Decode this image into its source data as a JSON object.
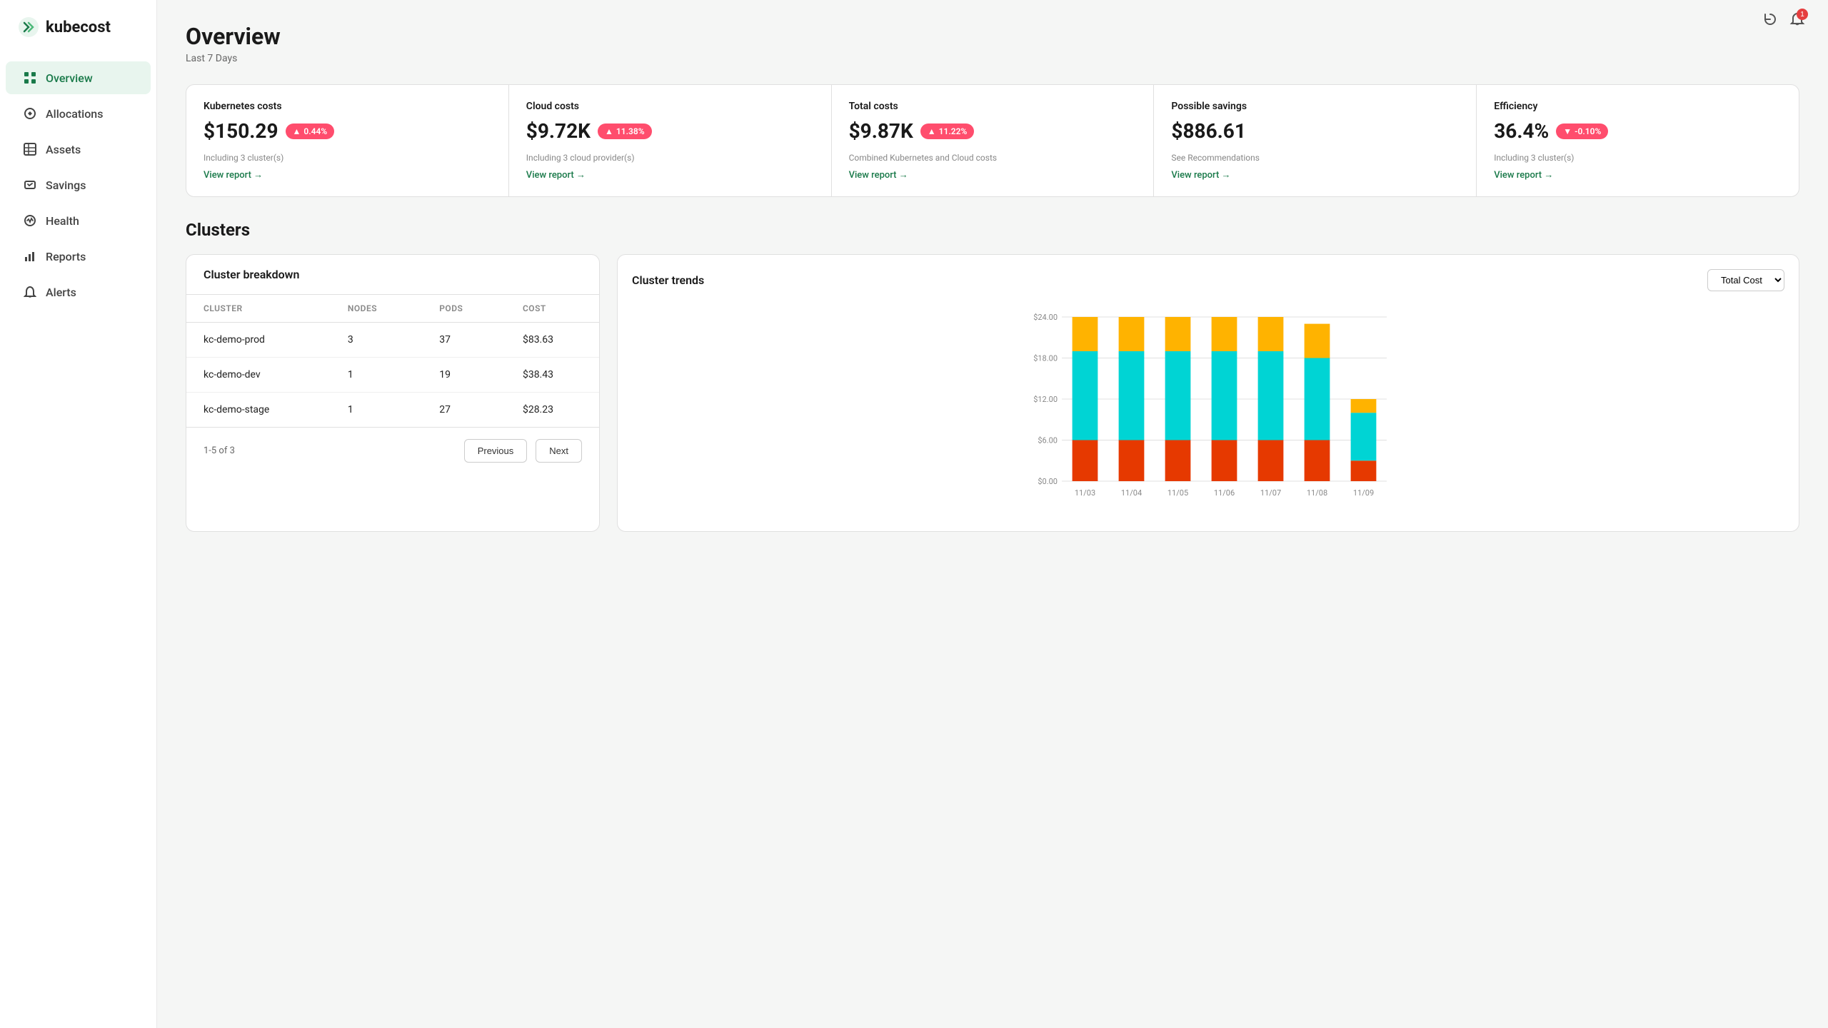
{
  "app": {
    "name": "kubecost",
    "logo_text": "kubecost"
  },
  "sidebar": {
    "items": [
      {
        "id": "overview",
        "label": "Overview",
        "icon": "grid-icon",
        "active": true
      },
      {
        "id": "allocations",
        "label": "Allocations",
        "icon": "tag-icon",
        "active": false
      },
      {
        "id": "assets",
        "label": "Assets",
        "icon": "table-icon",
        "active": false
      },
      {
        "id": "savings",
        "label": "Savings",
        "icon": "savings-icon",
        "active": false
      },
      {
        "id": "health",
        "label": "Health",
        "icon": "circle-icon",
        "active": false
      },
      {
        "id": "reports",
        "label": "Reports",
        "icon": "bar-icon",
        "active": false
      },
      {
        "id": "alerts",
        "label": "Alerts",
        "icon": "bell-icon",
        "active": false
      }
    ]
  },
  "header": {
    "title": "Overview",
    "subtitle": "Last 7 Days",
    "refresh_icon": "↻",
    "notification_icon": "🔔",
    "notification_count": "1"
  },
  "cost_cards": [
    {
      "id": "kubernetes-costs",
      "title": "Kubernetes costs",
      "value": "$150.29",
      "badge_value": "0.44%",
      "badge_direction": "up",
      "description": "Including 3 cluster(s)",
      "view_report_label": "View report →"
    },
    {
      "id": "cloud-costs",
      "title": "Cloud costs",
      "value": "$9.72K",
      "badge_value": "11.38%",
      "badge_direction": "up",
      "description": "Including 3 cloud provider(s)",
      "view_report_label": "View report →"
    },
    {
      "id": "total-costs",
      "title": "Total costs",
      "value": "$9.87K",
      "badge_value": "11.22%",
      "badge_direction": "up",
      "description": "Combined Kubernetes and Cloud costs",
      "view_report_label": "View report →"
    },
    {
      "id": "possible-savings",
      "title": "Possible savings",
      "value": "$886.61",
      "badge_value": null,
      "badge_direction": null,
      "description": "See Recommendations",
      "view_report_label": "View report →"
    },
    {
      "id": "efficiency",
      "title": "Efficiency",
      "value": "36.4%",
      "badge_value": "-0.10%",
      "badge_direction": "down",
      "description": "Including 3 cluster(s)",
      "view_report_label": "View report →"
    }
  ],
  "clusters": {
    "section_title": "Clusters",
    "table": {
      "title": "Cluster breakdown",
      "columns": [
        "CLUSTER",
        "NODES",
        "PODS",
        "COST"
      ],
      "rows": [
        {
          "cluster": "kc-demo-prod",
          "nodes": "3",
          "pods": "37",
          "cost": "$83.63"
        },
        {
          "cluster": "kc-demo-dev",
          "nodes": "1",
          "pods": "19",
          "cost": "$38.43"
        },
        {
          "cluster": "kc-demo-stage",
          "nodes": "1",
          "pods": "27",
          "cost": "$28.23"
        }
      ],
      "pagination": {
        "info": "1-5 of 3",
        "previous_label": "Previous",
        "next_label": "Next"
      }
    },
    "chart": {
      "title": "Cluster trends",
      "dropdown_label": "Total Cost",
      "dates": [
        "11/03",
        "11/04",
        "11/05",
        "11/06",
        "11/07",
        "11/08",
        "11/09"
      ],
      "y_labels": [
        "$0.00",
        "$6.00",
        "$12.00",
        "$18.00",
        "$24.00"
      ],
      "bars": [
        {
          "date": "11/03",
          "red": 6,
          "teal": 13,
          "orange": 5
        },
        {
          "date": "11/04",
          "red": 6,
          "teal": 13,
          "orange": 5
        },
        {
          "date": "11/05",
          "red": 6,
          "teal": 13,
          "orange": 5
        },
        {
          "date": "11/06",
          "red": 6,
          "teal": 13,
          "orange": 5
        },
        {
          "date": "11/07",
          "red": 6,
          "teal": 13,
          "orange": 5
        },
        {
          "date": "11/08",
          "red": 6,
          "teal": 12,
          "orange": 5
        },
        {
          "date": "11/09",
          "red": 3,
          "teal": 7,
          "orange": 2
        }
      ],
      "colors": {
        "red": "#e63900",
        "teal": "#00d4d4",
        "orange": "#ffb300"
      }
    }
  }
}
